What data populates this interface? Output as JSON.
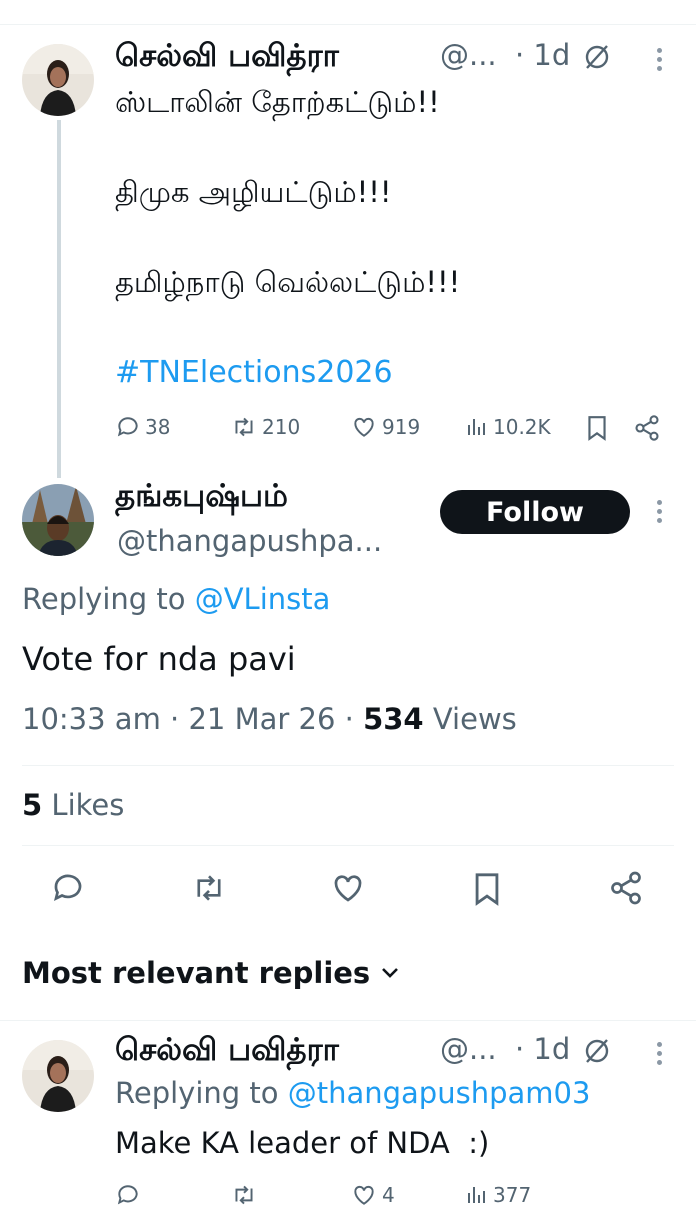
{
  "tweet1": {
    "author_name": "செல்வி பவித்ரா",
    "handle": "@...",
    "time": "· 1d",
    "lines": [
      "ஸ்டாலின் தோற்கட்டும்!!",
      "திமுக அழியட்டும்!!!",
      "தமிழ்நாடு வெல்லட்டும்!!!"
    ],
    "hashtag": "#TNElections2026",
    "stats": {
      "replies": "38",
      "retweets": "210",
      "likes": "919",
      "views": "10.2K"
    }
  },
  "main_tweet": {
    "author_name": "தங்கபுஷ்பம்",
    "handle": "@thangapushpa...",
    "follow_label": "Follow",
    "replying_prefix": "Replying to",
    "replying_handle": "@VLinsta",
    "text": "Vote for nda pavi",
    "timestamp": "10:33 am · 21 Mar 26 · ",
    "views_count": "534",
    "views_label": " Views",
    "likes_count": "5",
    "likes_label": " Likes"
  },
  "replies_header": {
    "label": "Most relevant replies"
  },
  "reply": {
    "author_name": "செல்வி பவித்ரா",
    "handle": "@...",
    "time": "· 1d",
    "replying_prefix": "Replying to",
    "replying_handle": "@thangapushpam03",
    "text": "Make KA leader of NDA  :)",
    "stats": {
      "replies": "",
      "retweets": "",
      "likes": "4",
      "views": "377"
    }
  },
  "colors": {
    "accent": "#1d9bf0",
    "text": "#0f1419",
    "muted": "#536471",
    "divider": "#eff3f4"
  }
}
